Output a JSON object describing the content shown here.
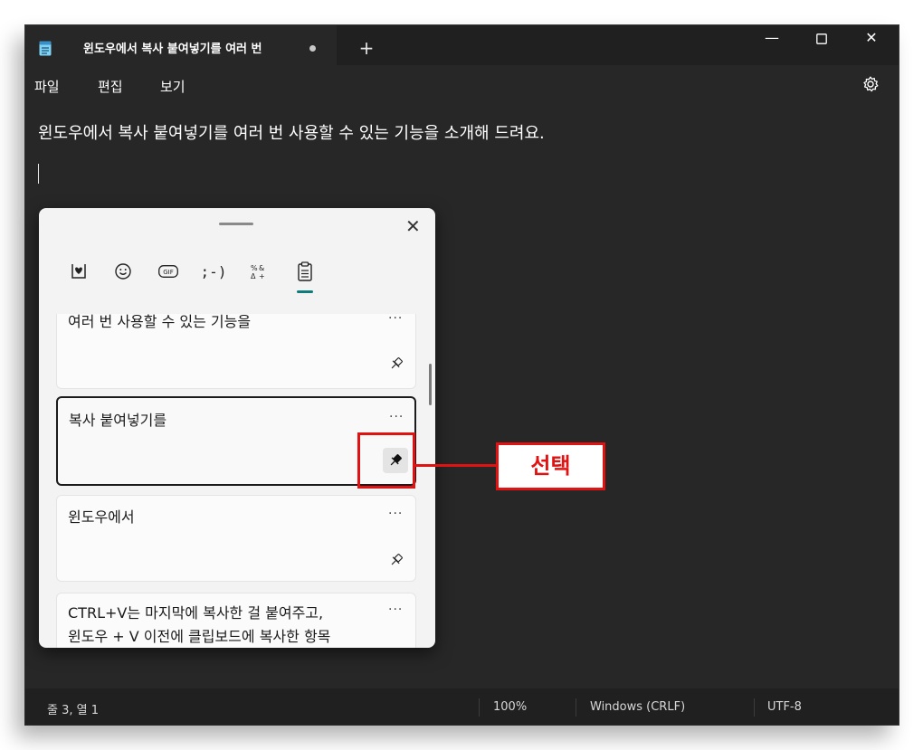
{
  "window": {
    "tab_title": "윈도우에서 복사 붙여넣기를 여러 번",
    "new_tab": "+",
    "minimize": "—",
    "close": "✕"
  },
  "menu": {
    "file": "파일",
    "edit": "편집",
    "view": "보기"
  },
  "editor": {
    "line1": "윈도우에서 복사 붙여넣기를 여러 번 사용할 수 있는 기능을 소개해 드려요."
  },
  "clipboard_panel": {
    "close": "✕",
    "categories": [
      "kaomoji-heart",
      "emoji",
      "gif",
      ";-)",
      "symbols",
      "clipboard"
    ],
    "kaomoji_label": ";-)",
    "items": [
      {
        "text": "여러 번 사용할 수 있는 기능을",
        "pinned": false
      },
      {
        "text": "복사 붙여넣기를",
        "pinned": true
      },
      {
        "text": "윈도우에서",
        "pinned": false
      },
      {
        "text_line1": "CTRL+V는 마지막에 복사한 걸 붙여주고,",
        "text_line2": "윈도우 + V 이전에 클립보드에 복사한 항목",
        "pinned": false
      }
    ],
    "more": "···"
  },
  "annotation": {
    "label": "선택",
    "color": "#e11212"
  },
  "status": {
    "position": "줄 3, 열 1",
    "zoom": "100%",
    "line_ending": "Windows (CRLF)",
    "encoding": "UTF-8"
  },
  "colors": {
    "window_bg": "#272727",
    "titlebar_bg": "#202020",
    "accent": "#0f7b7b"
  }
}
